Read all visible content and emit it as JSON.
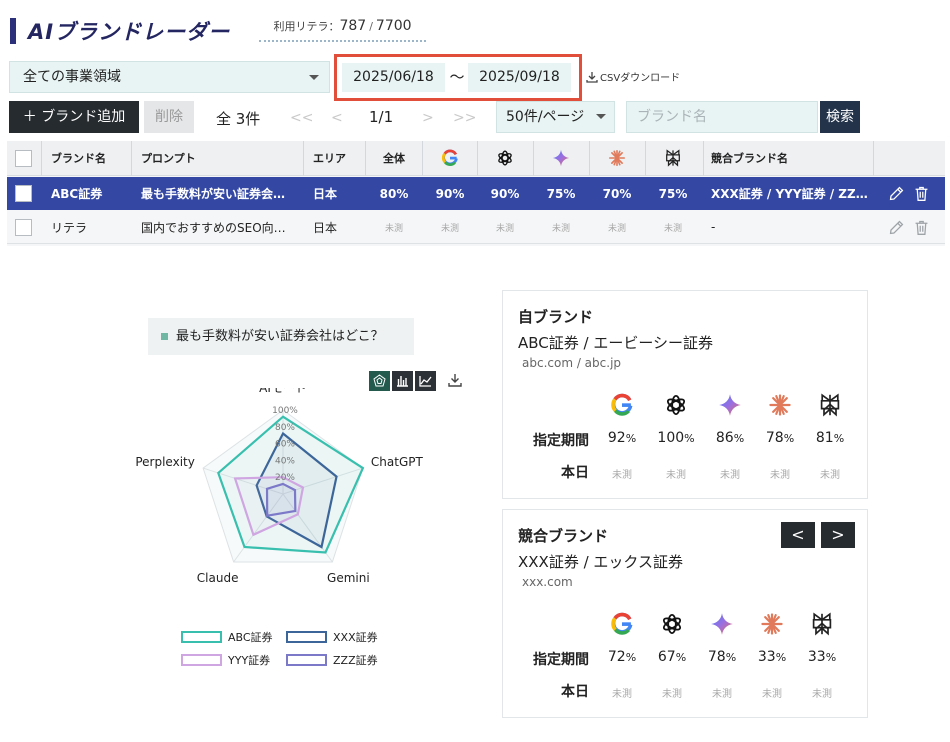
{
  "app": {
    "title": "AIブランドレーダー"
  },
  "usage": {
    "label": "利用リテラ：",
    "used": "787",
    "sep": "/",
    "total": "7700"
  },
  "filters": {
    "domain": "全ての事業領域",
    "date_from": "2025/06/18",
    "date_sep": "〜",
    "date_to": "2025/09/18",
    "csv": "CSVダウンロード"
  },
  "toolbar": {
    "add": "＋ ブランド追加",
    "delete": "削除",
    "count": "全 3件",
    "first": "<<",
    "prev": "<",
    "page": "1/1",
    "next": ">",
    "last": ">>",
    "per_page": "50件/ページ",
    "search_placeholder": "ブランド名",
    "search": "検索"
  },
  "table": {
    "headers": {
      "brand": "ブランド名",
      "prompt": "プロンプト",
      "area": "エリア",
      "total": "全体",
      "competitors": "競合ブランド名"
    },
    "rows": [
      {
        "brand": "ABC証券",
        "prompt": "最も手数料が安い証券会…",
        "area": "日本",
        "total": "80%",
        "google": "90%",
        "chatgpt": "90%",
        "gemini": "75%",
        "claude": "70%",
        "perplexity": "75%",
        "competitors": "XXX証券 / YYY証券 / ZZ…"
      },
      {
        "brand": "リテラ",
        "prompt": "国内でおすすめのSEO向…",
        "area": "日本",
        "total": "未測",
        "google": "未測",
        "chatgpt": "未測",
        "gemini": "未測",
        "claude": "未測",
        "perplexity": "未測",
        "competitors": "-"
      }
    ]
  },
  "chart_data": {
    "type": "radar",
    "prompt": "最も手数料が安い証券会社はどこ？",
    "axes": [
      "AIモード",
      "ChatGPT",
      "Gemini",
      "Claude",
      "Perplexity"
    ],
    "ticks": [
      "20%",
      "40%",
      "60%",
      "80%",
      "100%"
    ],
    "range": [
      0,
      100
    ],
    "series": [
      {
        "name": "ABC証券",
        "color": "#38bfae",
        "values": [
          92,
          100,
          86,
          78,
          81
        ]
      },
      {
        "name": "XXX証券",
        "color": "#3c6699",
        "values": [
          72,
          67,
          78,
          33,
          33
        ]
      },
      {
        "name": "YYY証券",
        "color": "#cfa6e1",
        "values": [
          20,
          25,
          30,
          60,
          60
        ]
      },
      {
        "name": "ZZZ証券",
        "color": "#7c79c9",
        "values": [
          12,
          15,
          25,
          32,
          20
        ]
      }
    ]
  },
  "own_card": {
    "heading": "自ブランド",
    "name": "ABC証券 / エービーシー証券",
    "domains": "abc.com / abc.jp",
    "period_label": "指定期間",
    "today_label": "本日",
    "values": [
      "92",
      "100",
      "86",
      "78",
      "81"
    ],
    "today": [
      "未測",
      "未測",
      "未測",
      "未測",
      "未測"
    ]
  },
  "comp_card": {
    "heading": "競合ブランド",
    "prev": "<",
    "next": ">",
    "name": "XXX証券 / エックス証券",
    "domains": "xxx.com",
    "period_label": "指定期間",
    "today_label": "本日",
    "values": [
      "72",
      "67",
      "78",
      "33",
      "33"
    ],
    "today": [
      "未測",
      "未測",
      "未測",
      "未測",
      "未測"
    ]
  },
  "pct": "%",
  "colors": {
    "accent": "#3347a3",
    "highlight": "#e14f3a",
    "dark": "#262b2f"
  }
}
